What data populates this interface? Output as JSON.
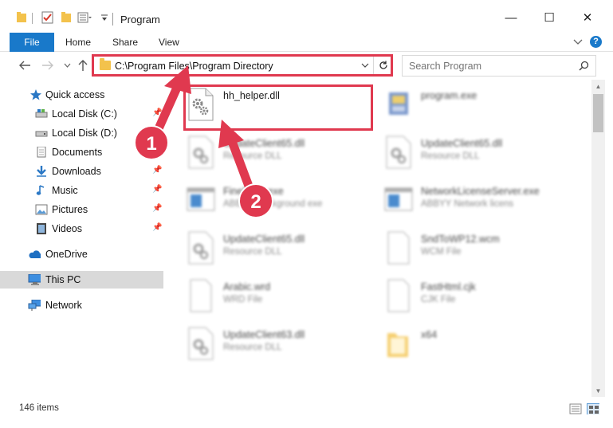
{
  "window": {
    "title": "Program",
    "controls": {
      "minimize": "—",
      "maximize": "☐",
      "close": "✕"
    }
  },
  "ribbon": {
    "tabs": [
      {
        "label": "File",
        "active": true
      },
      {
        "label": "Home"
      },
      {
        "label": "Share"
      },
      {
        "label": "View"
      }
    ],
    "collapse_icon": "chevron-down-icon",
    "help_label": "?"
  },
  "navigation": {
    "address_path": "C:\\Program Files\\Program Directory",
    "search_placeholder": "Search Program"
  },
  "sidebar": {
    "items": [
      {
        "label": "Quick access",
        "icon": "star-icon",
        "pinned": false
      },
      {
        "label": "Local Disk (C:)",
        "icon": "drive-icon",
        "pinned": true
      },
      {
        "label": "Local Disk (D:)",
        "icon": "drive-icon",
        "pinned": false
      },
      {
        "label": "Documents",
        "icon": "documents-icon",
        "pinned": true
      },
      {
        "label": "Downloads",
        "icon": "downloads-icon",
        "pinned": true
      },
      {
        "label": "Music",
        "icon": "music-icon",
        "pinned": true
      },
      {
        "label": "Pictures",
        "icon": "pictures-icon",
        "pinned": true
      },
      {
        "label": "Videos",
        "icon": "videos-icon",
        "pinned": true
      },
      {
        "label": "OneDrive",
        "icon": "cloud-icon",
        "pinned": false
      },
      {
        "label": "This PC",
        "icon": "computer-icon",
        "selected": true
      },
      {
        "label": "Network",
        "icon": "network-icon",
        "pinned": false
      }
    ]
  },
  "files": [
    {
      "name": "hh_helper.dll",
      "desc": "",
      "icon": "dll-gear-icon",
      "highlighted": true
    },
    {
      "name": "program.exe",
      "desc": "",
      "icon": "exe-icon"
    },
    {
      "name": "UpdateClient65.dll",
      "desc": "Resource DLL",
      "icon": "dll-gear-icon"
    },
    {
      "name": "UpdateClient65.dll",
      "desc": "Resource DLL",
      "icon": "dll-gear-icon"
    },
    {
      "name": "FineExec.exe",
      "desc": "ABBYY Background exe",
      "icon": "window-app-icon"
    },
    {
      "name": "NetworkLicenseServer.exe",
      "desc": "ABBYY Network licens",
      "icon": "window-app-icon"
    },
    {
      "name": "UpdateClient65.dll",
      "desc": "Resource DLL",
      "icon": "dll-gear-icon"
    },
    {
      "name": "SndToWP12.wcm",
      "desc": "WCM File",
      "icon": "blank-file-icon"
    },
    {
      "name": "Arabic.wrd",
      "desc": "WRD File",
      "icon": "blank-file-icon"
    },
    {
      "name": "FastHtml.cjk",
      "desc": "CJK File",
      "icon": "blank-file-icon"
    },
    {
      "name": "UpdateClient63.dll",
      "desc": "Resource DLL",
      "icon": "dll-gear-icon"
    },
    {
      "name": "x64",
      "desc": "",
      "icon": "folder-icon"
    }
  ],
  "annotations": {
    "step1": "1",
    "step2": "2",
    "color": "#e0394f"
  },
  "status": {
    "item_count": "146 items"
  },
  "colors": {
    "accent": "#1979ca",
    "folder": "#f3c24c",
    "highlight": "#e0394f",
    "selection": "#d9d9d9"
  }
}
